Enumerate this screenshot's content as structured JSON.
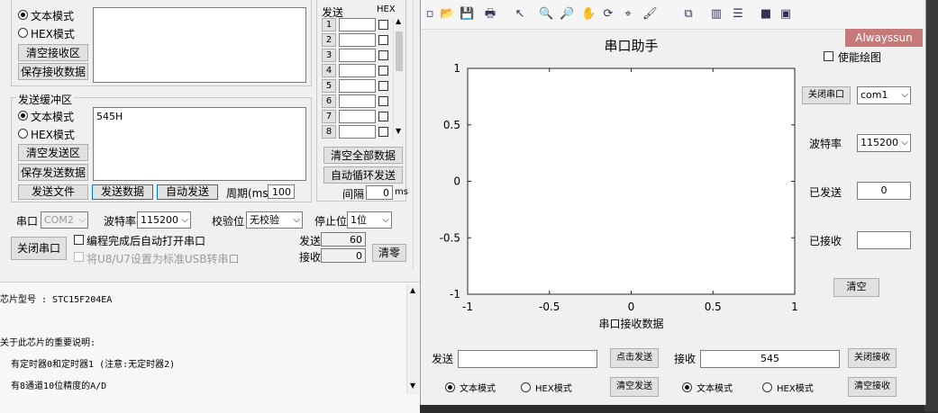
{
  "left": {
    "recv": {
      "text_mode": "文本模式",
      "hex_mode": "HEX模式",
      "clear_btn": "清空接收区",
      "save_btn": "保存接收数据"
    },
    "multi": {
      "send_header": "发送",
      "hex_header": "HEX",
      "rows": [
        "1",
        "2",
        "3",
        "4",
        "5",
        "6",
        "7",
        "8"
      ],
      "clear_all": "清空全部数据",
      "auto_loop": "自动循环发送",
      "interval_label": "间隔",
      "interval_value": "0",
      "interval_unit": "ms"
    },
    "send": {
      "group_title": "发送缓冲区",
      "text_mode": "文本模式",
      "hex_mode": "HEX模式",
      "buffer_text": "545H",
      "clear_btn": "清空发送区",
      "save_btn": "保存发送数据",
      "send_file": "发送文件",
      "send_data": "发送数据",
      "auto_send": "自动发送",
      "period_label": "周期(ms)",
      "period_value": "100"
    },
    "serial": {
      "port_label": "串口",
      "port_value": "COM2",
      "baud_label": "波特率",
      "baud_value": "115200",
      "parity_label": "校验位",
      "parity_value": "无校验",
      "stop_label": "停止位",
      "stop_value": "1位",
      "close_btn": "关闭串口",
      "auto_open_label": "编程完成后自动打开串口",
      "usb_label": "将U8/U7设置为标准USB转串口",
      "sent_label": "发送",
      "sent_value": "60",
      "recv_label": "接收",
      "recv_value": "0",
      "clear_btn": "清零"
    },
    "info": {
      "line1": "芯片型号 : STC15F204EA",
      "line2": "关于此芯片的重要说明:",
      "line3": "  有定时器0和定时器1 (注意:无定时器2)",
      "line4": "  有8通道10位精度的A/D"
    }
  },
  "right": {
    "toolbar_icons": [
      "new-file-icon",
      "open-folder-icon",
      "save-icon",
      "print-icon",
      "pointer-icon",
      "zoom-in-icon",
      "zoom-out-icon",
      "pan-hand-icon",
      "rotate-icon",
      "data-cursor-icon",
      "brush-icon",
      "link-plot-icon",
      "colorbar-icon",
      "legend-icon",
      "hide-plot-tools-icon",
      "show-plot-tools-icon"
    ],
    "badge": "Alwayssun",
    "enable_plot": "使能绘图",
    "chart_data": {
      "type": "line",
      "title": "串口助手",
      "xlabel": "串口接收数据",
      "ylabel": "",
      "xlim": [
        -1,
        1
      ],
      "ylim": [
        -1,
        1
      ],
      "xticks": [
        "-1",
        "-0.5",
        "0",
        "0.5",
        "1"
      ],
      "yticks": [
        "1",
        "0.5",
        "0",
        "-0.5",
        "-1"
      ],
      "series": []
    },
    "controls": {
      "close_port": "关闭串口",
      "com_value": "com1",
      "baud_label": "波特率",
      "baud_value": "115200",
      "sent_label": "已发送",
      "sent_value": "0",
      "recv_label": "已接收",
      "recv_value": "",
      "clear_btn": "清空"
    },
    "bottom": {
      "send_label": "发送",
      "send_value": "",
      "click_send": "点击发送",
      "recv_label": "接收",
      "recv_value": "545",
      "close_recv": "关闭接收",
      "text_mode_1": "文本模式",
      "hex_mode_1": "HEX模式",
      "clear_send": "清空发送",
      "text_mode_2": "文本模式",
      "hex_mode_2": "HEX模式",
      "clear_recv": "清空接收"
    }
  }
}
